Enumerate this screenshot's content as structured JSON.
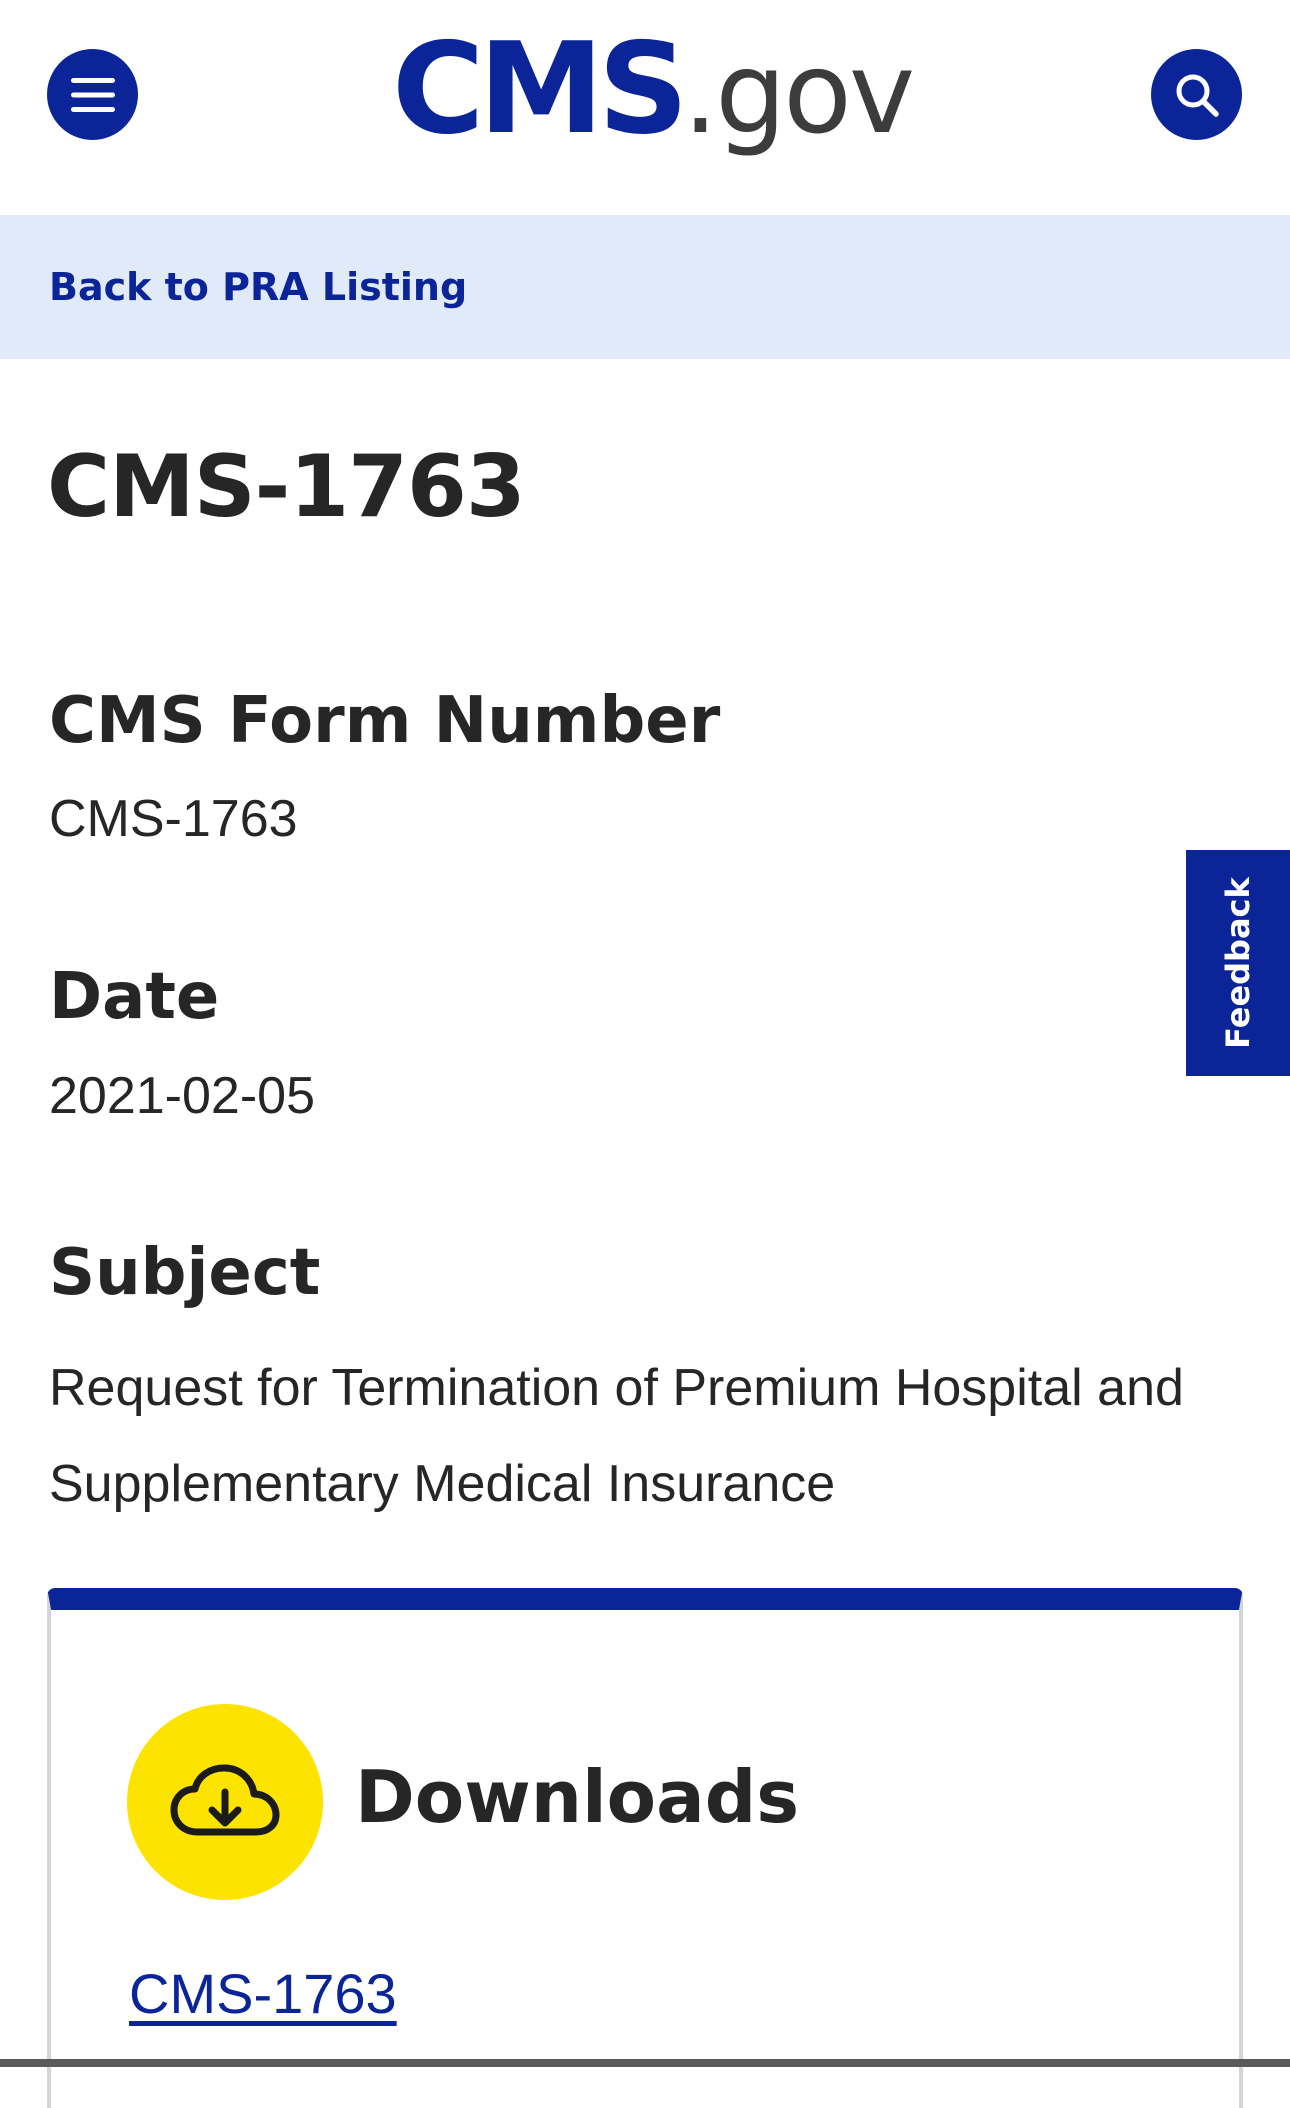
{
  "header": {
    "logo_cms": "CMS",
    "logo_gov": ".gov",
    "menu_icon": "hamburger-menu-icon",
    "search_icon": "search-icon"
  },
  "back_link": "Back to PRA Listing",
  "page_title": "CMS-1763",
  "fields": {
    "form_number_label": "CMS Form Number",
    "form_number_value": "CMS-1763",
    "date_label": "Date",
    "date_value": "2021-02-05",
    "subject_label": "Subject",
    "subject_value": "Request for Termination of Premium Hospital and Supplementary Medical Insurance"
  },
  "feedback": "Feedback",
  "downloads": {
    "title": "Downloads",
    "icon": "cloud-download-icon",
    "link": "CMS-1763"
  },
  "colors": {
    "brand_blue": "#0b2599",
    "back_bar_bg": "#e1eaf8",
    "icon_yellow": "#fde300",
    "text_dark": "#262626"
  }
}
